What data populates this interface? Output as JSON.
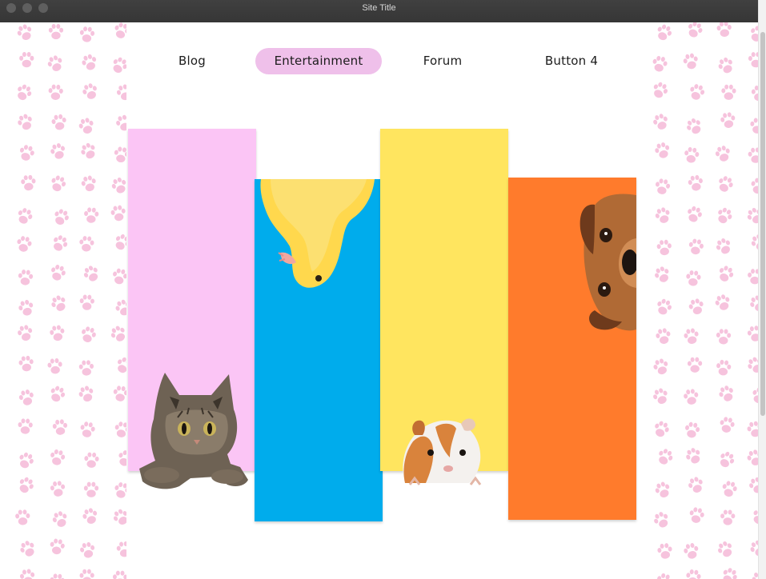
{
  "window": {
    "title": "Site Title"
  },
  "nav": {
    "items": [
      {
        "label": "Blog",
        "active": false
      },
      {
        "label": "Entertainment",
        "active": true
      },
      {
        "label": "Forum",
        "active": false
      },
      {
        "label": "Button 4",
        "active": false
      }
    ]
  },
  "columns": [
    {
      "color": "#fbc5f5",
      "image": "cat"
    },
    {
      "color": "#00acec",
      "image": "duckling-upside-down"
    },
    {
      "color": "#ffe55f",
      "image": "guinea-pig"
    },
    {
      "color": "#ff7b2c",
      "image": "dog-peeking"
    }
  ],
  "colors": {
    "active_nav": "#efc0ea",
    "paw_print": "#f6c3dd"
  }
}
